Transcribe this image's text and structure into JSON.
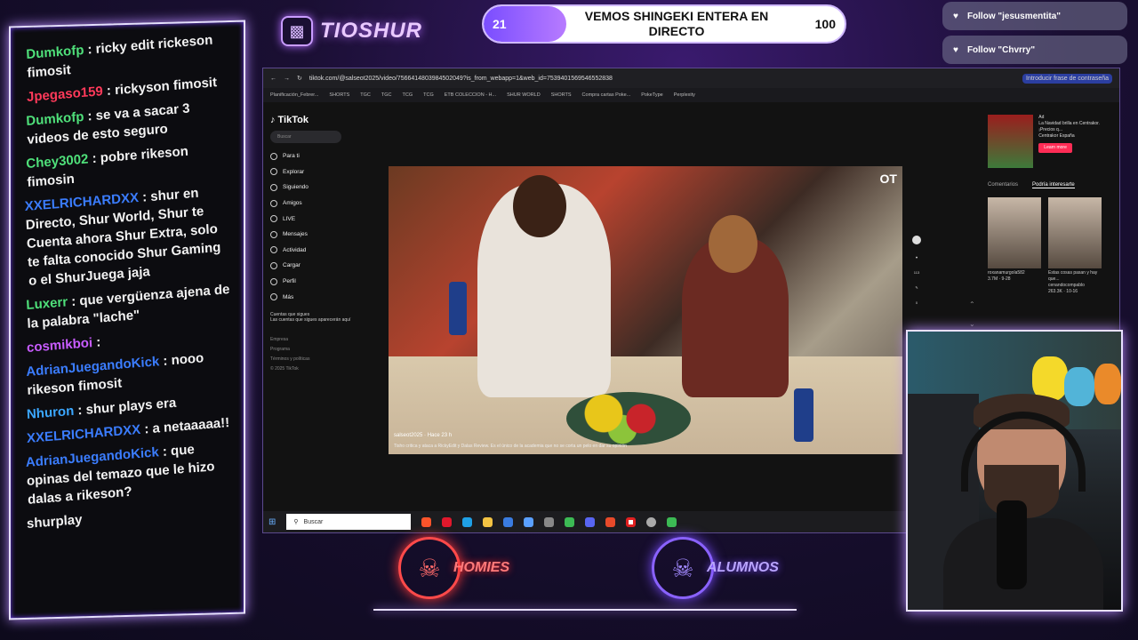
{
  "chat": {
    "messages": [
      {
        "user": "Dumkofp",
        "user_color": "#4fe07a",
        "text": "ricky edit rickeson fimosit"
      },
      {
        "user": "Jpegaso159",
        "user_color": "#ff3a5a",
        "text": "rickyson fimosit"
      },
      {
        "user": "Dumkofp",
        "user_color": "#4fe07a",
        "text": "se va a sacar 3 videos de esto seguro"
      },
      {
        "user": "Chey3002",
        "user_color": "#4fe07a",
        "text": "pobre rikeson fimosin"
      },
      {
        "user": "XXELRICHARDXX",
        "user_color": "#3b7dff",
        "text": "shur en Directo, Shur World, Shur te Cuenta ahora Shur Extra, solo te falta conocido Shur Gaming o el ShurJuega jaja"
      },
      {
        "user": "Luxerr",
        "user_color": "#4fe07a",
        "text": "que vergüenza ajena de la palabra \"lache\""
      },
      {
        "user": "cosmikboi",
        "user_color": "#c85cff",
        "text": ""
      },
      {
        "user": "AdrianJuegandoKick",
        "user_color": "#3b7dff",
        "text": "nooo rikeson fimosit"
      },
      {
        "user": "Nhuron",
        "user_color": "#3ba7ff",
        "text": "shur plays era"
      },
      {
        "user": "XXELRICHARDXX",
        "user_color": "#3b7dff",
        "text": "a netaaaaa!!"
      },
      {
        "user": "AdrianJuegandoKick",
        "user_color": "#3b7dff",
        "text": "que opinas del temazo que le hizo dalas a rikeson?"
      },
      {
        "user": "",
        "user_color": "#ffffff",
        "text": "shurplay"
      }
    ]
  },
  "brand": {
    "name": "TIOSHUR"
  },
  "goal": {
    "start": "21",
    "title": "VEMOS SHINGEKI ENTERA EN DIRECTO",
    "end": "100",
    "progress": 0.21
  },
  "alerts": [
    "Follow \"jesusmentita\"",
    "Follow \"Chvrry\""
  ],
  "browser": {
    "url": "tiktok.com/@salseot2025/video/7566414803984502049?is_from_webapp=1&web_id=7539401569546552838",
    "password_hint": "Introducir frase de contraseña",
    "bookmarks": [
      "Planificación_Febrer...",
      "SHORTS",
      "TGC",
      "TGC",
      "TCG",
      "TCG",
      "ETB COLECCION - H...",
      "SHUR WORLD",
      "SHORTS",
      "Compra cartas Poke...",
      "PokeType",
      "Perplexity"
    ]
  },
  "tiktok": {
    "logo": "TikTok",
    "search_placeholder": "Buscar",
    "nav": [
      "Para ti",
      "Explorar",
      "Siguiendo",
      "Amigos",
      "LIVE",
      "Mensajes",
      "Actividad",
      "Cargar",
      "Perfil",
      "Más"
    ],
    "following_title": "Cuentas que sigues",
    "following_desc": "Las cuentas que sigues aparecerán aquí",
    "footer": [
      "Empresa",
      "Programa",
      "Términos y políticas",
      "© 2025 TikTok"
    ],
    "video": {
      "brand": "OT",
      "author": "salseot2025 · Hace 23 h",
      "description": "Tisho critica y ataca a RickyEdit y Dalas Review. Es el único de la academia que no se corta un pelo en dar su opinión"
    },
    "counts": [
      "113",
      "0"
    ],
    "ad": {
      "label": "Ad",
      "text": "La Navidad brilla en Centrakor. ¡Precios q...",
      "sponsor": "Centrakor España",
      "button": "Learn more"
    },
    "tabs": [
      "Comentarios",
      "Podría interesarte"
    ],
    "related": [
      {
        "author": "roxanamurgola582",
        "meta": "3.7M · 9-28"
      },
      {
        "title": "Estas cosas pasan y hay que...",
        "author": "cenandocompablo",
        "meta": "263.3K · 10-16"
      }
    ]
  },
  "taskbar": {
    "search_placeholder": "Buscar"
  },
  "bottom": {
    "left": "HOMIES",
    "right": "ALUMNOS"
  }
}
